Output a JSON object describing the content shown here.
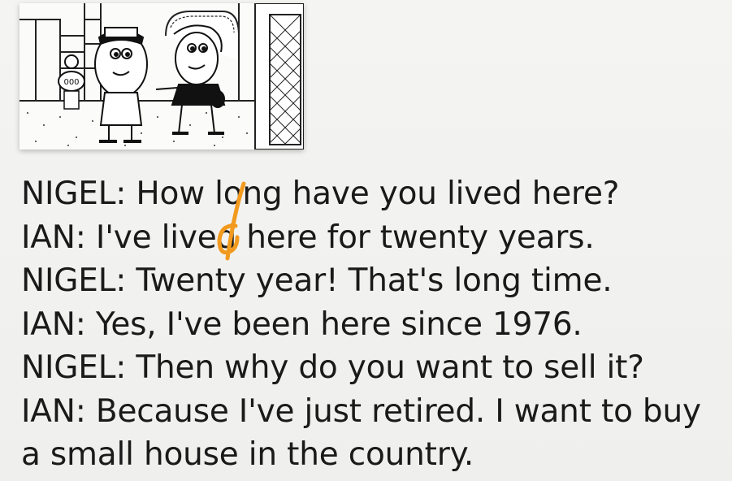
{
  "illustration": {
    "badge_text": "000"
  },
  "dialogue": [
    {
      "text": "NIGEL: How long have you lived here?"
    },
    {
      "text": "IAN: I've lived here for twenty years."
    },
    {
      "text": "NIGEL: Twenty year! That's long time."
    },
    {
      "text": "IAN: Yes, I've been here since 1976."
    },
    {
      "text": "NIGEL: Then why do you want to sell it?"
    },
    {
      "text": "IAN: Because I've just retired. I want to buy"
    },
    {
      "text": "a small house in the country."
    }
  ],
  "annotation": {
    "color": "#f29a1e"
  }
}
